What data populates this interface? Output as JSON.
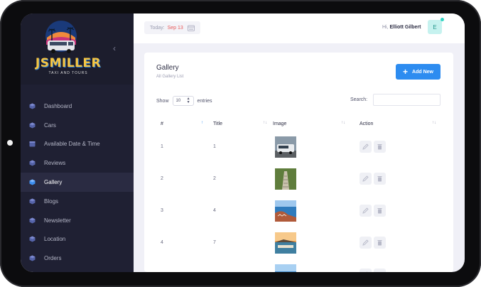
{
  "brand": {
    "title": "JSMILLER",
    "subtitle": "TAXI AND TOURS"
  },
  "sidebar": {
    "items": [
      {
        "label": "Dashboard",
        "icon": "cube-icon",
        "active": false
      },
      {
        "label": "Cars",
        "icon": "cube-icon",
        "active": false
      },
      {
        "label": "Available Date & Time",
        "icon": "calendar-icon",
        "active": false
      },
      {
        "label": "Reviews",
        "icon": "cube-icon",
        "active": false
      },
      {
        "label": "Gallery",
        "icon": "cube-icon",
        "active": true
      },
      {
        "label": "Blogs",
        "icon": "cube-icon",
        "active": false
      },
      {
        "label": "Newsletter",
        "icon": "cube-icon",
        "active": false
      },
      {
        "label": "Location",
        "icon": "cube-icon",
        "active": false
      },
      {
        "label": "Orders",
        "icon": "cube-icon",
        "active": false
      }
    ]
  },
  "topbar": {
    "today_label": "Today:",
    "today_date": "Sep 13",
    "greeting": "Hi,",
    "user_name": "Elliott Gilbert",
    "avatar_initial": "E"
  },
  "page": {
    "title": "Gallery",
    "subtitle": "All Gallery List",
    "add_button": "Add New"
  },
  "table_controls": {
    "show_label": "Show",
    "entries_value": "10",
    "entries_label": "entries",
    "search_label": "Search:",
    "search_value": ""
  },
  "table": {
    "columns": [
      "#",
      "Title",
      "Image",
      "Action"
    ],
    "rows": [
      {
        "num": "1",
        "title": "1",
        "image": "van-photo"
      },
      {
        "num": "2",
        "title": "2",
        "image": "stairs-photo"
      },
      {
        "num": "3",
        "title": "4",
        "image": "coast-photo"
      },
      {
        "num": "4",
        "title": "7",
        "image": "sunset-photo"
      },
      {
        "num": "",
        "title": "",
        "image": "sea-photo"
      }
    ]
  },
  "colors": {
    "accent": "#2d8cf0",
    "sidebar_bg": "#1f2033",
    "date_red": "#e85a5a",
    "logo_yellow": "#f5c542"
  }
}
